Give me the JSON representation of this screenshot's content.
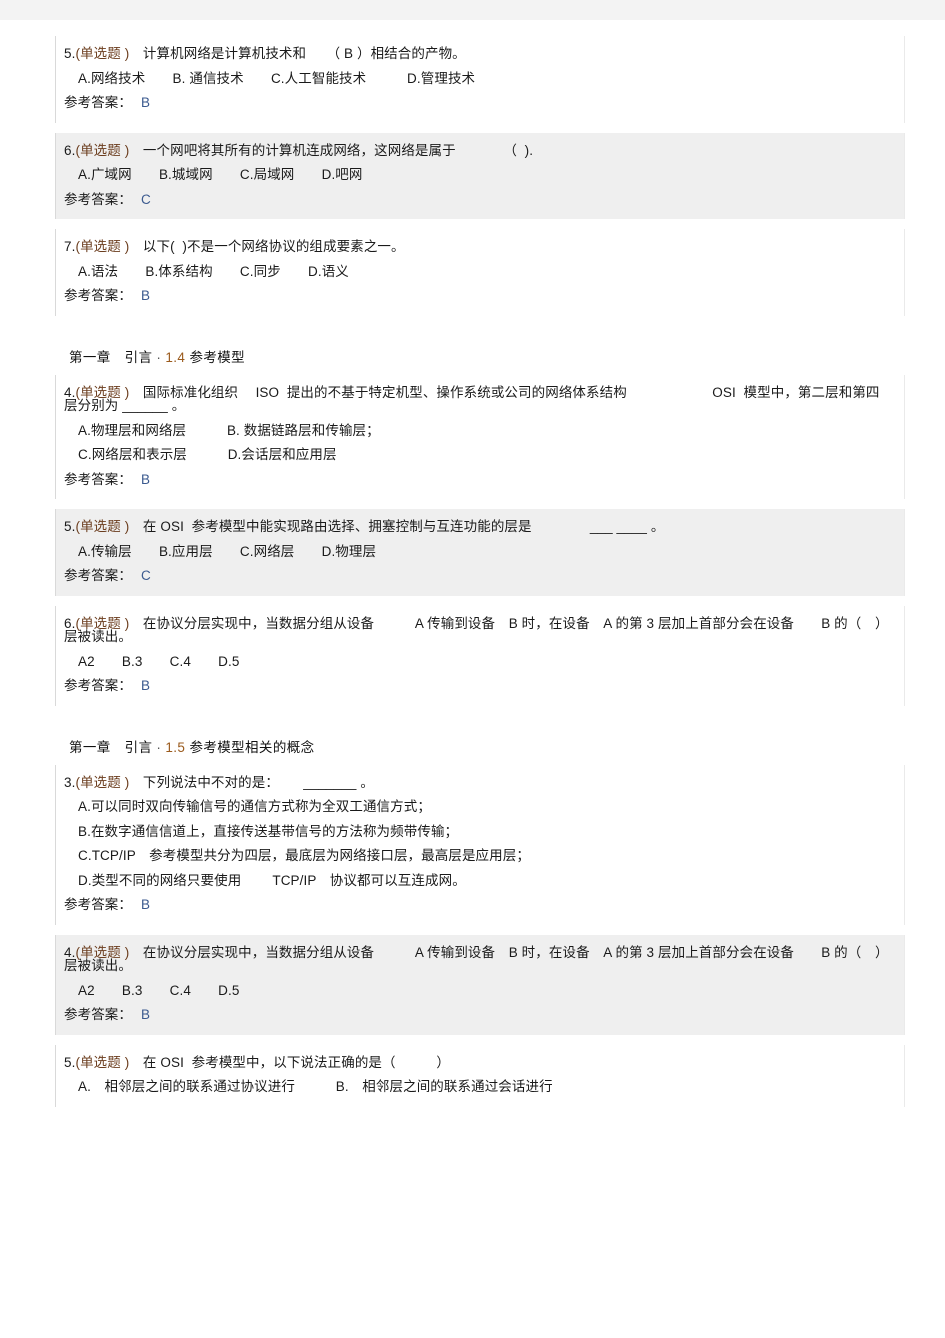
{
  "document": {
    "page_background": "#ffffff",
    "block_gray": "#efefef",
    "accent_section_number": "#9a5a1c",
    "answer_letter_color": "#3b5a8f"
  },
  "labels": {
    "answer_prefix": "参考答案：",
    "question_type": "(单选题 )"
  },
  "sections": [
    {
      "id": "section-top",
      "heading": null,
      "questions": [
        {
          "number": "5.",
          "type": "(单选题 )",
          "stem": "计算机网络是计算机技术和　　（ B ）相结合的产物。",
          "options": [
            "A.网络技术　　B. 通信技术　　C.人工智能技术　　　D.管理技术"
          ],
          "answer": "B",
          "shade": "white"
        },
        {
          "number": "6.",
          "type": "(单选题 )",
          "stem": "一个网吧将其所有的计算机连成网络，这网络是属于　　　　（  ).",
          "options": [
            "A.广域网　　B.城域网　　C.局域网　　D.吧网"
          ],
          "answer": "C",
          "shade": "gray"
        },
        {
          "number": "7.",
          "type": "(单选题 )",
          "stem": "以下(  )不是一个网络协议的组成要素之一。",
          "options": [
            "A.语法　　B.体系结构　　C.同步　　D.语义"
          ],
          "answer": "B",
          "shade": "white"
        }
      ]
    },
    {
      "id": "section-1-4",
      "heading": {
        "chapter": "第一章　引言",
        "dot": "·",
        "number": "1.4",
        "title": "参考模型"
      },
      "questions": [
        {
          "number": "4.",
          "type": "(单选题 )",
          "stem": "国际标准化组织　 ISO  提出的不基于特定机型、操作系统或公司的网络体系结构　　　　　　 OSI  模型中，第二层和第四层分别为 ______ 。",
          "options": [
            "A.物理层和网络层　　　B. 数据链路层和传输层；",
            "C.网络层和表示层　　　D.会话层和应用层"
          ],
          "answer": "B",
          "shade": "white"
        },
        {
          "number": "5.",
          "type": "(单选题 )",
          "stem": "在 OSI  参考模型中能实现路由选择、拥塞控制与互连功能的层是　　　　 ___ ____ 。",
          "options": [
            "A.传输层　　B.应用层　　C.网络层　　D.物理层"
          ],
          "answer": "C",
          "shade": "gray"
        },
        {
          "number": "6.",
          "type": "(单选题 )",
          "stem": "在协议分层实现中，当数据分组从设备　　　A 传输到设备　B 时，在设备　A 的第 3 层加上首部分会在设备　　B 的（　）层被读出。",
          "options": [
            "A2　　B.3　　C.4　　D.5"
          ],
          "answer": "B",
          "shade": "white"
        }
      ]
    },
    {
      "id": "section-1-5",
      "heading": {
        "chapter": "第一章　引言",
        "dot": "·",
        "number": "1.5",
        "title": "参考模型相关的概念"
      },
      "questions": [
        {
          "number": "3.",
          "type": "(单选题 )",
          "stem": "下列说法中不对的是：　　 _______ 。",
          "options": [
            "A.可以同时双向传输信号的通信方式称为全双工通信方式；",
            "B.在数字通信信道上，直接传送基带信号的方法称为频带传输；",
            "C.TCP/IP　参考模型共分为四层，最底层为网络接口层，最高层是应用层；",
            "D.类型不同的网络只要使用　　 TCP/IP　协议都可以互连成网。"
          ],
          "answer": "B",
          "shade": "white"
        },
        {
          "number": "4.",
          "type": "(单选题 )",
          "stem": "在协议分层实现中，当数据分组从设备　　　A 传输到设备　B 时，在设备　A 的第 3 层加上首部分会在设备　　B 的（　）层被读出。",
          "options": [
            "A2　　B.3　　C.4　　D.5"
          ],
          "answer": "B",
          "shade": "gray"
        },
        {
          "number": "5.",
          "type": "(单选题 )",
          "stem": "在 OSI  参考模型中，以下说法正确的是（　　　）",
          "options": [
            "A.　相邻层之间的联系通过协议进行　　　B.　相邻层之间的联系通过会话进行"
          ],
          "answer": null,
          "shade": "white"
        }
      ]
    }
  ]
}
